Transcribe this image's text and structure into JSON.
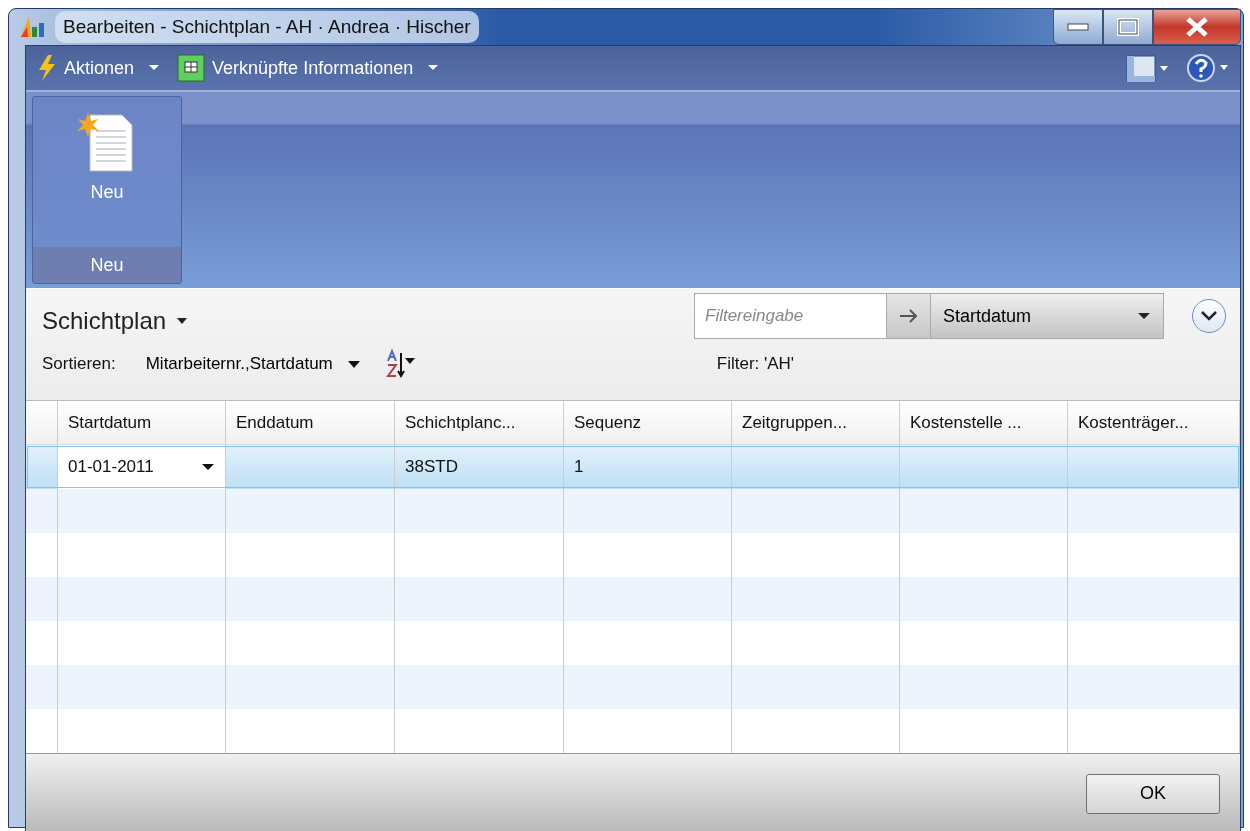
{
  "window": {
    "title": "Bearbeiten - Schichtplan - AH · Andrea · Hischer"
  },
  "command_bar": [
    {
      "label": "Aktionen",
      "kind": "actions"
    },
    {
      "label": "Verknüpfte Informationen",
      "kind": "related"
    }
  ],
  "ribbon": {
    "groups": [
      {
        "label": "Neu",
        "buttons": [
          {
            "label": "Neu"
          }
        ]
      }
    ]
  },
  "section": {
    "title": "Schichtplan",
    "sort_label": "Sortieren:",
    "sort_value": "Mitarbeiternr.,Startdatum",
    "filter": {
      "placeholder": "Filtereingabe",
      "field": "Startdatum"
    },
    "filter_text": "Filter: 'AH'"
  },
  "table": {
    "columns": [
      "Startdatum",
      "Enddatum",
      "Schichtplanc...",
      "Sequenz",
      "Zeitgruppen...",
      "Kostenstelle ...",
      "Kostenträger..."
    ],
    "rows": [
      {
        "selected": true,
        "cells": [
          "01-01-2011",
          "",
          "38STD",
          "1",
          "",
          "",
          ""
        ]
      }
    ]
  },
  "buttons": [
    {
      "label": "OK"
    }
  ]
}
